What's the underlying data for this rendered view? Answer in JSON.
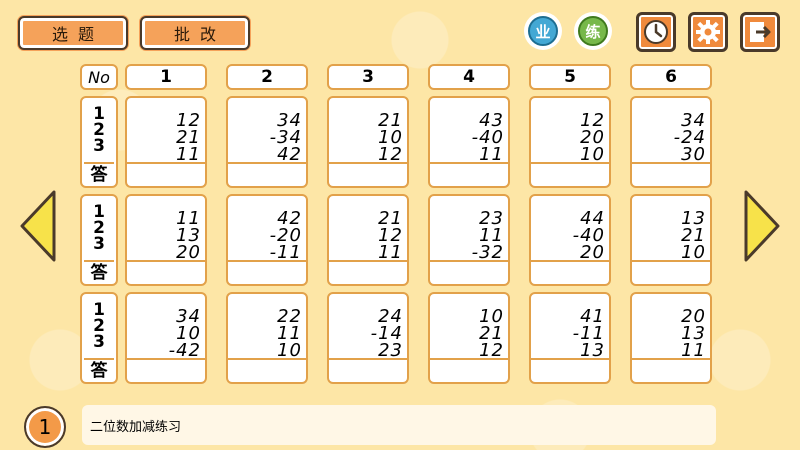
{
  "toolbar": {
    "select_label": "选题",
    "grade_label": "批改",
    "badge_ye": "业",
    "badge_lian": "练",
    "colors": {
      "button_orange": "#f5a25a",
      "badge_blue": "#43a8d4",
      "badge_green": "#77b84a"
    }
  },
  "grid": {
    "no_label": "No",
    "answer_label": "答",
    "line_numbers": [
      "1",
      "2",
      "3"
    ],
    "columns": [
      "1",
      "2",
      "3",
      "4",
      "5",
      "6"
    ],
    "rows": [
      [
        [
          "12",
          "21",
          "11"
        ],
        [
          "34",
          "-34",
          "42"
        ],
        [
          "21",
          "10",
          "12"
        ],
        [
          "43",
          "-40",
          "11"
        ],
        [
          "12",
          "20",
          "10"
        ],
        [
          "34",
          "-24",
          "30"
        ]
      ],
      [
        [
          "11",
          "13",
          "20"
        ],
        [
          "42",
          "-20",
          "-11"
        ],
        [
          "21",
          "12",
          "11"
        ],
        [
          "23",
          "11",
          "-32"
        ],
        [
          "44",
          "-40",
          "20"
        ],
        [
          "13",
          "21",
          "10"
        ]
      ],
      [
        [
          "34",
          "10",
          "-42"
        ],
        [
          "22",
          "11",
          "10"
        ],
        [
          "24",
          "-14",
          "23"
        ],
        [
          "10",
          "21",
          "12"
        ],
        [
          "41",
          "-11",
          "13"
        ],
        [
          "20",
          "13",
          "11"
        ]
      ]
    ]
  },
  "footer": {
    "page_number": "1",
    "title": "二位数加减练习"
  }
}
